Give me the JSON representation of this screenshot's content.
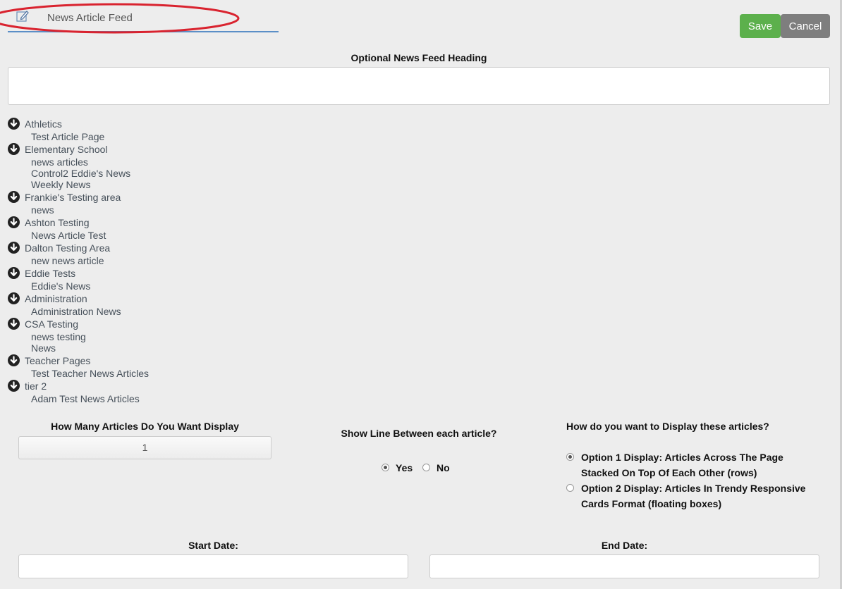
{
  "header": {
    "title": "News Article Feed",
    "save_label": "Save",
    "cancel_label": "Cancel",
    "edit_icon": "pencil-edit-icon"
  },
  "heading": {
    "label": "Optional News Feed Heading",
    "value": ""
  },
  "categories": [
    {
      "name": "Athletics",
      "items": [
        "Test Article Page"
      ]
    },
    {
      "name": "Elementary School",
      "items": [
        "news articles",
        "Control2 Eddie's News",
        "Weekly News"
      ]
    },
    {
      "name": "Frankie's Testing area",
      "items": [
        "news"
      ]
    },
    {
      "name": "Ashton Testing",
      "items": [
        "News Article Test"
      ]
    },
    {
      "name": "Dalton Testing Area",
      "items": [
        "new news article"
      ]
    },
    {
      "name": "Eddie Tests",
      "items": [
        "Eddie's News"
      ]
    },
    {
      "name": "Administration",
      "items": [
        "Administration News"
      ]
    },
    {
      "name": "CSA Testing",
      "items": [
        "news testing",
        "News"
      ]
    },
    {
      "name": "Teacher Pages",
      "items": [
        "Test Teacher News Articles"
      ]
    },
    {
      "name": "tier 2",
      "items": [
        "Adam Test News Articles"
      ]
    }
  ],
  "article_count": {
    "label": "How Many Articles Do You Want Display",
    "value": "1"
  },
  "line_between": {
    "label": "Show Line Between each article?",
    "yes": "Yes",
    "no": "No",
    "selected": "Yes"
  },
  "display_mode": {
    "label": "How do you want to Display these articles?",
    "option1_line1": "Option 1 Display: Articles Across The Page",
    "option1_line2": "Stacked On Top Of Each Other (rows)",
    "option2_line1": "Option 2 Display: Articles In Trendy Responsive",
    "option2_line2": "Cards Format (floating boxes)",
    "selected": "Option 1"
  },
  "dates": {
    "start_label": "Start Date:",
    "end_label": "End Date:",
    "start_value": "",
    "end_value": ""
  },
  "colors": {
    "save": "#5cb04c",
    "cancel": "#7e7e7e",
    "annotation_ellipse": "#d9232f",
    "title_underline": "#5b8fc7"
  }
}
